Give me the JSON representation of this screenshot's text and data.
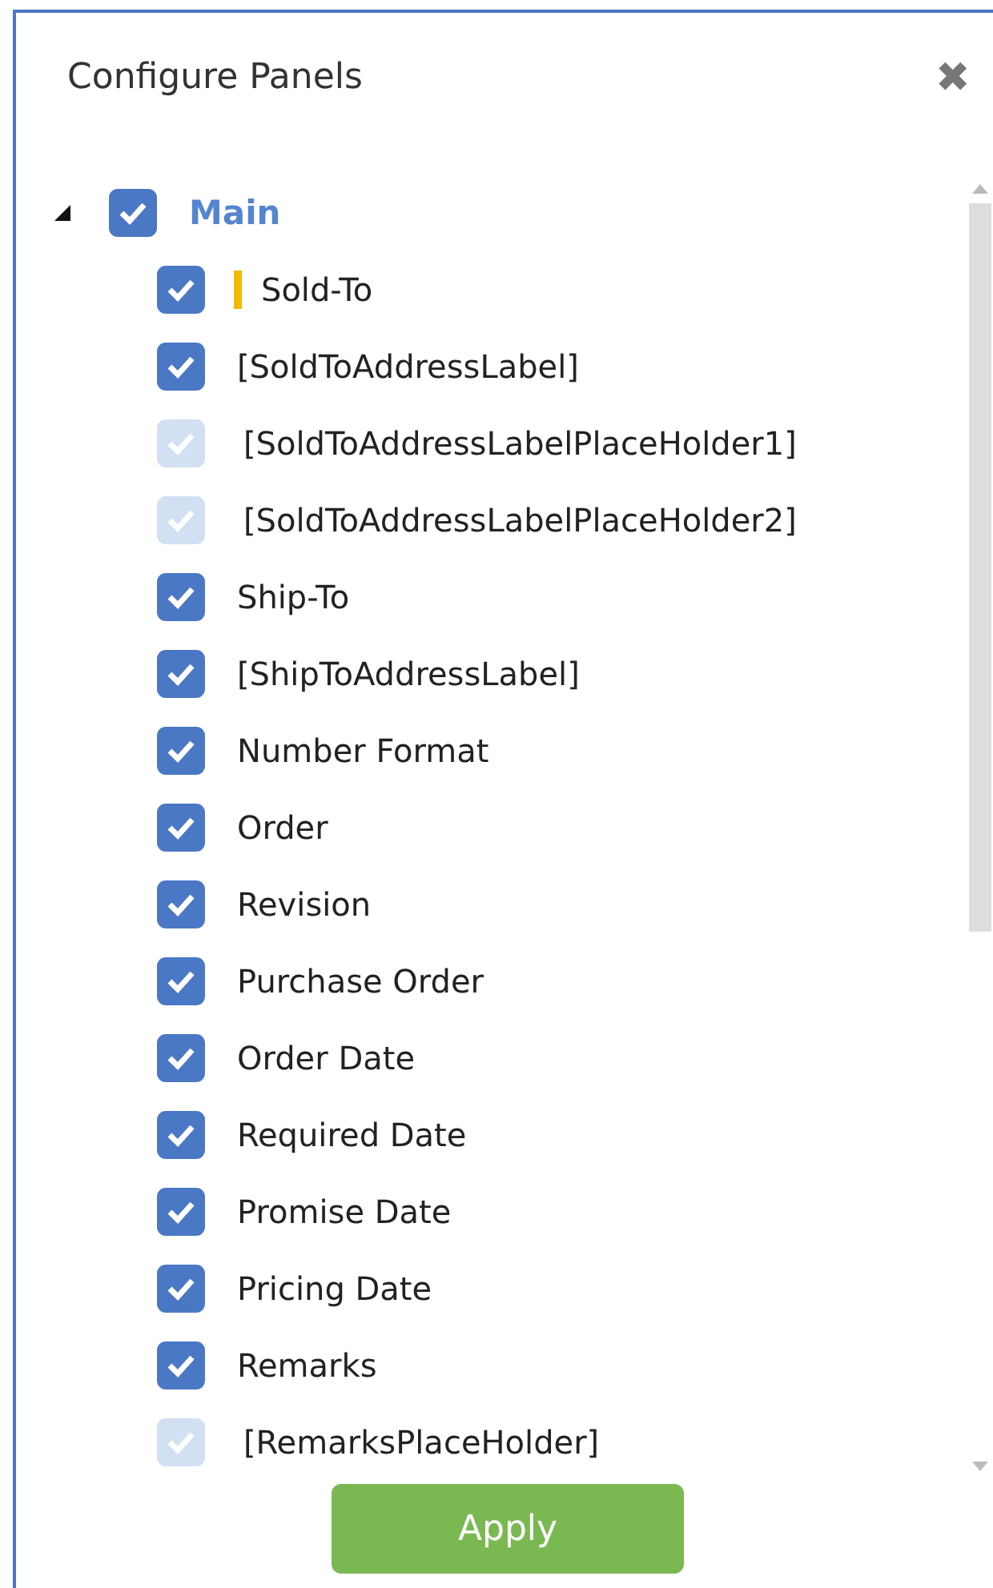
{
  "dialog": {
    "title": "Configure Panels",
    "close_icon": "✖"
  },
  "tree": {
    "label": "Main",
    "checked": true,
    "expanded": true,
    "children": [
      {
        "label": "Sold-To",
        "checked": true,
        "disabled": false,
        "focused": true
      },
      {
        "label": "[SoldToAddressLabel]",
        "checked": true,
        "disabled": false,
        "focused": false
      },
      {
        "label": "[SoldToAddressLabelPlaceHolder1]",
        "checked": true,
        "disabled": true,
        "focused": false
      },
      {
        "label": "[SoldToAddressLabelPlaceHolder2]",
        "checked": true,
        "disabled": true,
        "focused": false
      },
      {
        "label": "Ship-To",
        "checked": true,
        "disabled": false,
        "focused": false
      },
      {
        "label": "[ShipToAddressLabel]",
        "checked": true,
        "disabled": false,
        "focused": false
      },
      {
        "label": "Number Format",
        "checked": true,
        "disabled": false,
        "focused": false
      },
      {
        "label": "Order",
        "checked": true,
        "disabled": false,
        "focused": false
      },
      {
        "label": "Revision",
        "checked": true,
        "disabled": false,
        "focused": false
      },
      {
        "label": "Purchase Order",
        "checked": true,
        "disabled": false,
        "focused": false
      },
      {
        "label": "Order Date",
        "checked": true,
        "disabled": false,
        "focused": false
      },
      {
        "label": "Required Date",
        "checked": true,
        "disabled": false,
        "focused": false
      },
      {
        "label": "Promise Date",
        "checked": true,
        "disabled": false,
        "focused": false
      },
      {
        "label": "Pricing Date",
        "checked": true,
        "disabled": false,
        "focused": false
      },
      {
        "label": "Remarks",
        "checked": true,
        "disabled": false,
        "focused": false
      },
      {
        "label": "[RemarksPlaceHolder]",
        "checked": true,
        "disabled": true,
        "focused": false
      }
    ]
  },
  "apply_button": "Apply"
}
